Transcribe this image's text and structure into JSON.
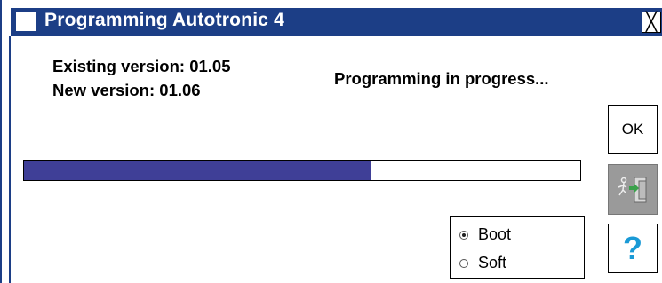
{
  "window": {
    "title": "Programming Autotronic 4",
    "close_glyph": "╳"
  },
  "versions": {
    "existing": "Existing version: 01.05",
    "new": "New version: 01.06"
  },
  "status_text": "Programming in progress...",
  "progress": {
    "fraction": 0.625
  },
  "buttons": {
    "ok_label": "OK",
    "exit_icon": "exit-door-icon",
    "help_label": "?"
  },
  "mode": {
    "options": [
      "Boot",
      "Soft"
    ],
    "selected": "Boot"
  },
  "colors": {
    "titlebar": "#1c3e86",
    "progress_fill": "#3f3f97",
    "help": "#1a9ad6",
    "exit_bg": "#9a9a9a",
    "exit_accent": "#3aa14b"
  }
}
